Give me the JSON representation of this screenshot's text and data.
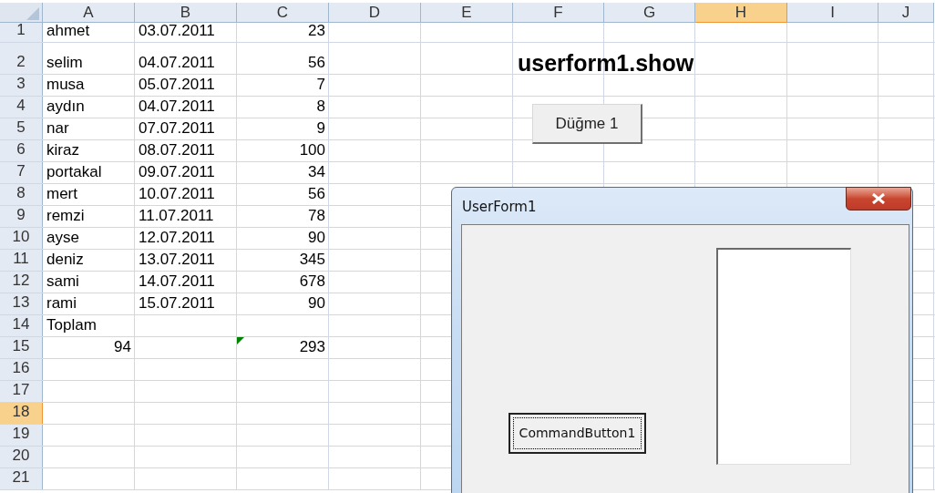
{
  "sheet": {
    "columns": [
      {
        "label": "A",
        "selected": false
      },
      {
        "label": "B",
        "selected": false
      },
      {
        "label": "C",
        "selected": false
      },
      {
        "label": "D",
        "selected": false
      },
      {
        "label": "E",
        "selected": false
      },
      {
        "label": "F",
        "selected": false
      },
      {
        "label": "G",
        "selected": false
      },
      {
        "label": "H",
        "selected": true
      },
      {
        "label": "I",
        "selected": false
      },
      {
        "label": "J",
        "selected": false
      }
    ],
    "rows": [
      {
        "label": "1",
        "selected": false,
        "cells": [
          {
            "kind": "text",
            "text": "ahmet"
          },
          {
            "kind": "text",
            "text": "03.07.2011"
          },
          {
            "kind": "number",
            "text": "23"
          }
        ]
      },
      {
        "label": "2",
        "selected": false,
        "cells": [
          {
            "kind": "text",
            "text": "selim"
          },
          {
            "kind": "text",
            "text": "04.07.2011"
          },
          {
            "kind": "number",
            "text": "56"
          }
        ]
      },
      {
        "label": "3",
        "selected": false,
        "cells": [
          {
            "kind": "text",
            "text": "musa"
          },
          {
            "kind": "text",
            "text": "05.07.2011"
          },
          {
            "kind": "number",
            "text": "7"
          }
        ]
      },
      {
        "label": "4",
        "selected": false,
        "cells": [
          {
            "kind": "text",
            "text": "aydın"
          },
          {
            "kind": "text",
            "text": "04.07.2011"
          },
          {
            "kind": "number",
            "text": "8"
          }
        ]
      },
      {
        "label": "5",
        "selected": false,
        "cells": [
          {
            "kind": "text",
            "text": "nar"
          },
          {
            "kind": "text",
            "text": "07.07.2011"
          },
          {
            "kind": "number",
            "text": "9"
          }
        ]
      },
      {
        "label": "6",
        "selected": false,
        "cells": [
          {
            "kind": "text",
            "text": "kiraz"
          },
          {
            "kind": "text",
            "text": "08.07.2011"
          },
          {
            "kind": "number",
            "text": "100"
          }
        ]
      },
      {
        "label": "7",
        "selected": false,
        "cells": [
          {
            "kind": "text",
            "text": "portakal"
          },
          {
            "kind": "text",
            "text": "09.07.2011"
          },
          {
            "kind": "number",
            "text": "34"
          }
        ]
      },
      {
        "label": "8",
        "selected": false,
        "cells": [
          {
            "kind": "text",
            "text": "mert"
          },
          {
            "kind": "text",
            "text": "10.07.2011"
          },
          {
            "kind": "number",
            "text": "56"
          }
        ]
      },
      {
        "label": "9",
        "selected": false,
        "cells": [
          {
            "kind": "text",
            "text": "remzi"
          },
          {
            "kind": "text",
            "text": "11.07.2011"
          },
          {
            "kind": "number",
            "text": "78"
          }
        ]
      },
      {
        "label": "10",
        "selected": false,
        "cells": [
          {
            "kind": "text",
            "text": "ayse"
          },
          {
            "kind": "text",
            "text": "12.07.2011"
          },
          {
            "kind": "number",
            "text": "90"
          }
        ]
      },
      {
        "label": "11",
        "selected": false,
        "cells": [
          {
            "kind": "text",
            "text": "deniz"
          },
          {
            "kind": "text",
            "text": "13.07.2011"
          },
          {
            "kind": "number",
            "text": "345"
          }
        ]
      },
      {
        "label": "12",
        "selected": false,
        "cells": [
          {
            "kind": "text",
            "text": "sami"
          },
          {
            "kind": "text",
            "text": "14.07.2011"
          },
          {
            "kind": "number",
            "text": "678"
          }
        ]
      },
      {
        "label": "13",
        "selected": false,
        "cells": [
          {
            "kind": "text",
            "text": "rami"
          },
          {
            "kind": "text",
            "text": "15.07.2011"
          },
          {
            "kind": "number",
            "text": "90"
          }
        ]
      },
      {
        "label": "14",
        "selected": false,
        "cells": [
          {
            "kind": "text",
            "text": "Toplam"
          }
        ]
      },
      {
        "label": "15",
        "selected": false,
        "cells": [
          {
            "kind": "number",
            "text": "94"
          },
          {
            "kind": "empty"
          },
          {
            "kind": "number",
            "text": "293",
            "flagged": true
          }
        ]
      },
      {
        "label": "16",
        "selected": false
      },
      {
        "label": "17",
        "selected": false
      },
      {
        "label": "18",
        "selected": true
      },
      {
        "label": "19",
        "selected": false
      },
      {
        "label": "20",
        "selected": false
      },
      {
        "label": "21",
        "selected": false
      }
    ]
  },
  "sheet_heading": "userform1.show",
  "sheet_button": "Düğme 1",
  "userform": {
    "title": "UserForm1",
    "command_button": "CommandButton1"
  }
}
